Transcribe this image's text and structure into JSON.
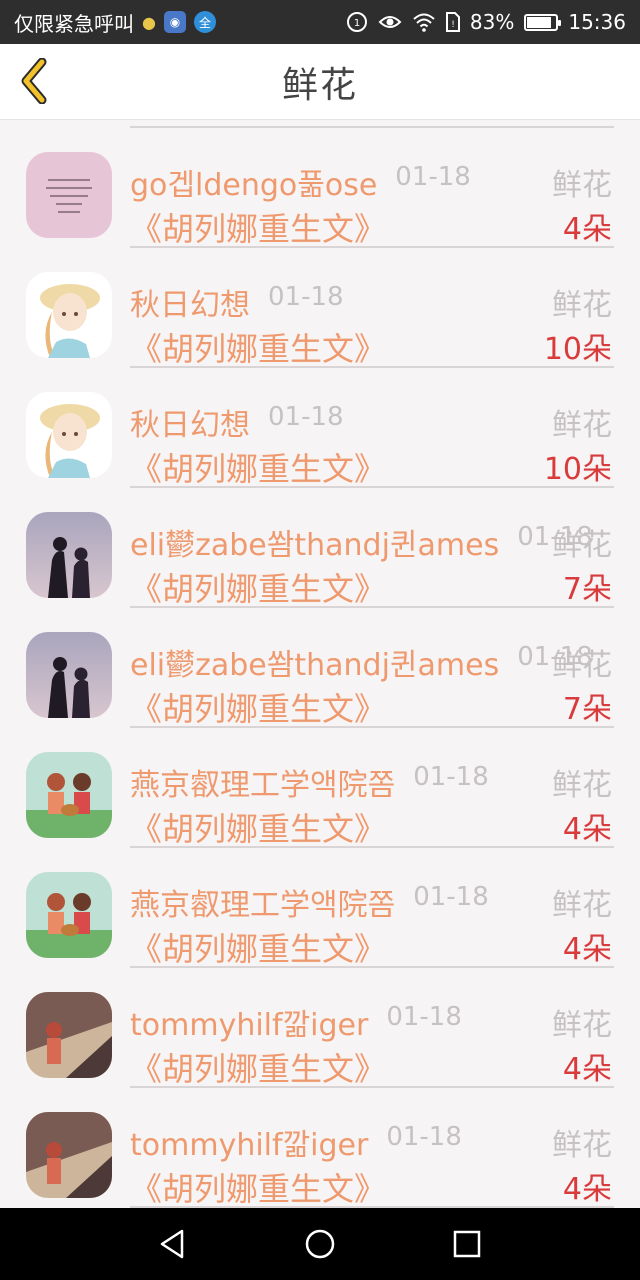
{
  "status_bar": {
    "carrier": "仅限紧急呼叫",
    "battery": "83%",
    "time": "15:36",
    "battery_level": 0.83,
    "icons": [
      "bulb-icon",
      "app-icon",
      "app-icon-2",
      "hd-icon",
      "eye-icon",
      "wifi-icon",
      "sim-icon",
      "battery-icon"
    ]
  },
  "header": {
    "title": "鲜花",
    "back_icon": "chevron-left-icon",
    "accent": "#f2c22a"
  },
  "colors": {
    "name": "#ee9a6e",
    "count": "#d93a3a",
    "muted": "#c6c2c4"
  },
  "gifts": [
    {
      "user": "go겝ldengo풂ose",
      "date": "01-18",
      "type": "鲜花",
      "book": "《胡列娜重生文》",
      "count": "4朵",
      "avatar": "text-note"
    },
    {
      "user": "秋日幻想",
      "date": "01-18",
      "type": "鲜花",
      "book": "《胡列娜重生文》",
      "count": "10朵",
      "avatar": "girl-hat"
    },
    {
      "user": "秋日幻想",
      "date": "01-18",
      "type": "鲜花",
      "book": "《胡列娜重生文》",
      "count": "10朵",
      "avatar": "girl-hat"
    },
    {
      "user": "eli鬰zabe쐄thandj퀸ames",
      "date": "01-18",
      "type": "鲜花",
      "book": "《胡列娜重生文》",
      "count": "7朵",
      "avatar": "couple-dusk"
    },
    {
      "user": "eli鬰zabe쐄thandj퀸ames",
      "date": "01-18",
      "type": "鲜花",
      "book": "《胡列娜重生文》",
      "count": "7朵",
      "avatar": "couple-dusk"
    },
    {
      "user": "燕京㕡理工学액院쫌",
      "date": "01-18",
      "type": "鲜花",
      "book": "《胡列娜重生文》",
      "count": "4朵",
      "avatar": "couple-guitar"
    },
    {
      "user": "燕京㕡理工学액院쫌",
      "date": "01-18",
      "type": "鲜花",
      "book": "《胡列娜重生文》",
      "count": "4朵",
      "avatar": "couple-guitar"
    },
    {
      "user": "tommyhilf깖iger",
      "date": "01-18",
      "type": "鲜花",
      "book": "《胡列娜重生文》",
      "count": "4朵",
      "avatar": "girl-train"
    },
    {
      "user": "tommyhilf깖iger",
      "date": "01-18",
      "type": "鲜花",
      "book": "《胡列娜重生文》",
      "count": "4朵",
      "avatar": "girl-train"
    }
  ],
  "nav_bar": {
    "icons": [
      "back-triangle-icon",
      "home-circle-icon",
      "recents-square-icon"
    ]
  }
}
